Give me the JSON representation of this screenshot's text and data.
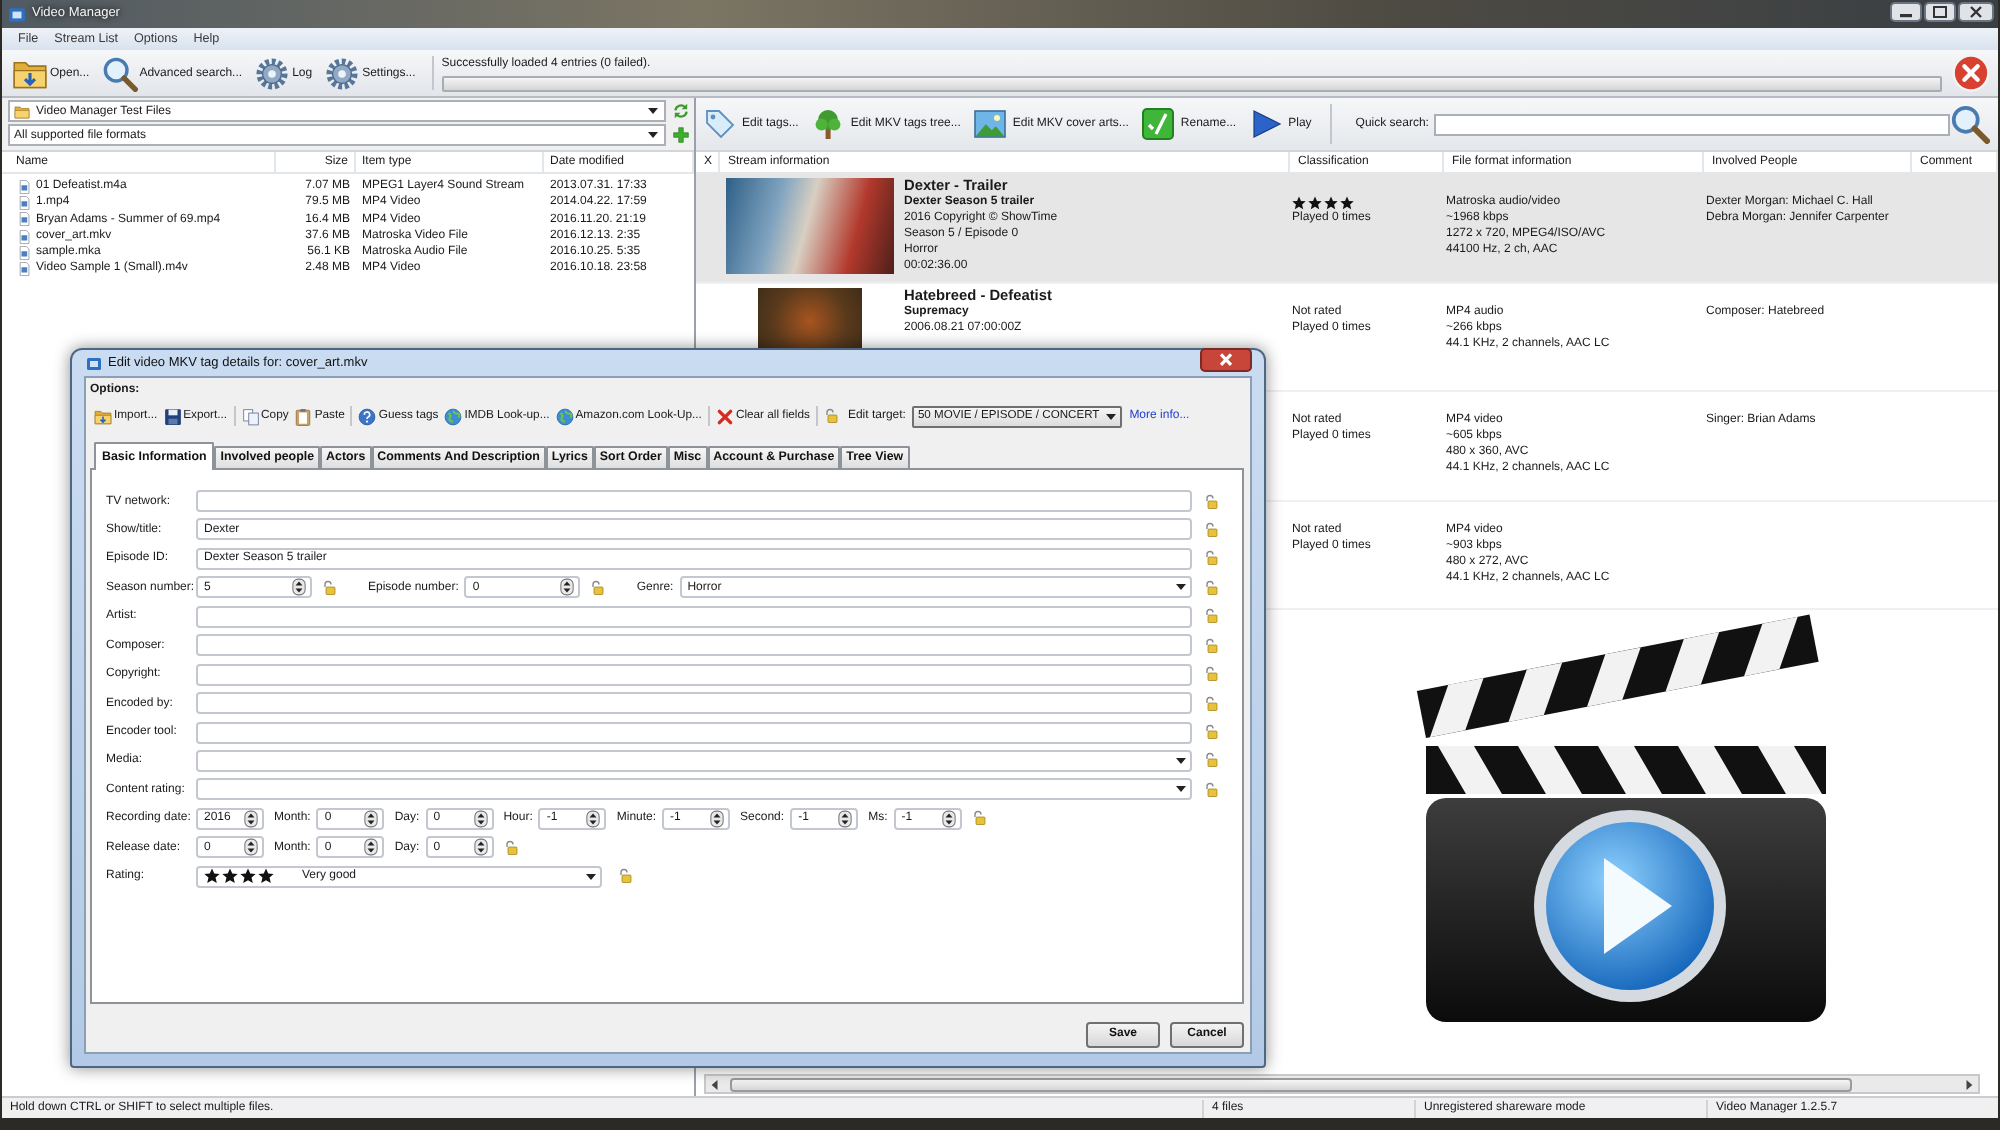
{
  "window": {
    "title": "Video Manager"
  },
  "menu": [
    "File",
    "Stream List",
    "Options",
    "Help"
  ],
  "toolbar": [
    "Open...",
    "Advanced search...",
    "Log",
    "Settings..."
  ],
  "status_message": "Successfully loaded 4 entries (0 failed).",
  "progress": {
    "level": 0
  },
  "file_panel": {
    "folder": "Video Manager Test Files",
    "filter": "All supported file formats",
    "columns": [
      "Name",
      "Size",
      "Item type",
      "Date modified"
    ],
    "rows": [
      {
        "name": "01 Defeatist.m4a",
        "size": "7.07 MB",
        "type": "MPEG1 Layer4 Sound Stream",
        "date": "2013.07.31. 17:33",
        "selected": false
      },
      {
        "name": "1.mp4",
        "size": "79.5 MB",
        "type": "MP4 Video",
        "date": "2014.04.22. 17:59",
        "selected": false
      },
      {
        "name": "Bryan Adams - Summer of 69.mp4",
        "size": "16.4 MB",
        "type": "MP4 Video",
        "date": "2016.11.20. 21:19",
        "selected": false
      },
      {
        "name": "cover_art.mkv",
        "size": "37.6 MB",
        "type": "Matroska Video File",
        "date": "2016.12.13. 2:35",
        "selected": false
      },
      {
        "name": "sample.mka",
        "size": "56.1 KB",
        "type": "Matroska Audio File",
        "date": "2016.10.25. 5:35",
        "selected": false
      },
      {
        "name": "Video Sample 1 (Small).m4v",
        "size": "2.48 MB",
        "type": "MP4 Video",
        "date": "2016.10.18. 23:58",
        "selected": false
      }
    ]
  },
  "stream_panel": {
    "toolbar": [
      "Edit tags...",
      "Edit MKV tags tree...",
      "Edit MKV cover arts...",
      "Rename...",
      "Play"
    ],
    "quick_search": {
      "label": "Quick search:"
    },
    "columns": [
      "X",
      "Stream information",
      "Classification",
      "File format information",
      "Involved People",
      "Comment"
    ],
    "rows": [
      {
        "selected": true,
        "info": {
          "kind": "video",
          "title": "Dexter - Trailer",
          "subtitle": "Dexter Season 5 trailer",
          "lines": [
            "2016 Copyright © ShowTime",
            "Season 5 / Episode 0",
            "Horror",
            "00:02:36.00"
          ]
        },
        "classification": {
          "stars": 4,
          "played": "Played 0 times"
        },
        "format": [
          "Matroska audio/video",
          "~1968 kbps",
          "1272 x 720, MPEG4/ISO/AVC",
          "44100 Hz, 2 ch, AAC"
        ],
        "people": [
          "Dexter Morgan: Michael C. Hall",
          "Debra Morgan: Jennifer Carpenter"
        ]
      },
      {
        "selected": false,
        "info": {
          "kind": "audio",
          "title": "Hatebreed - Defeatist",
          "subtitle": "Supremacy",
          "lines": [
            "2006.08.21 07:00:00Z"
          ]
        },
        "classification": {
          "rating": "Not rated",
          "played": "Played 0 times"
        },
        "format": [
          "MP4 audio",
          "~266 kbps",
          "44.1 KHz, 2 channels, AAC LC"
        ],
        "people": [
          "Composer: Hatebreed"
        ]
      },
      {
        "selected": false,
        "classification": {
          "rating": "Not rated",
          "played": "Played 0 times"
        },
        "format": [
          "MP4 video",
          "~605 kbps",
          "480 x 360, AVC",
          "44.1 KHz, 2 channels, AAC LC"
        ],
        "people": [
          "Singer: Brian Adams"
        ]
      },
      {
        "selected": false,
        "classification": {
          "rating": "Not rated",
          "played": "Played 0 times"
        },
        "format": [
          "MP4 video",
          "~903 kbps",
          "480 x 272, AVC",
          "44.1 KHz, 2 channels, AAC LC"
        ]
      }
    ]
  },
  "dialog": {
    "title": "Edit video MKV tag details for: cover_art.mkv",
    "options_label": "Options:",
    "toolbar": [
      [
        "Import...",
        "Export..."
      ],
      [
        "Copy",
        "Paste"
      ],
      [
        "Guess tags",
        "IMDB Look-up...",
        "Amazon.com Look-Up..."
      ],
      [
        "Clear all fields"
      ]
    ],
    "edit_target": {
      "label": "Edit target:",
      "value": "50 MOVIE / EPISODE / CONCERT"
    },
    "more_info": "More info...",
    "tabs": [
      {
        "label": "Basic Information",
        "selected": true
      },
      {
        "label": "Involved people",
        "selected": false
      },
      {
        "label": "Actors",
        "selected": false
      },
      {
        "label": "Comments And Description",
        "selected": false
      },
      {
        "label": "Lyrics",
        "selected": false
      },
      {
        "label": "Sort Order",
        "selected": false
      },
      {
        "label": "Misc",
        "selected": false
      },
      {
        "label": "Account & Purchase",
        "selected": false
      },
      {
        "label": "Tree View",
        "selected": false
      }
    ],
    "form": [
      {
        "kind": "text",
        "label": "TV network:"
      },
      {
        "kind": "text",
        "label": "Show/title:",
        "value": "Dexter"
      },
      {
        "kind": "text",
        "label": "Episode ID:",
        "value": "Dexter Season 5 trailer"
      },
      {
        "kind": "numbers",
        "parts": [
          {
            "kind": "spin",
            "label": "Season number:",
            "value": "5"
          },
          {
            "kind": "spin",
            "label": "Episode number:",
            "value": "0"
          },
          {
            "kind": "combo",
            "label": "Genre:",
            "value": "Horror"
          }
        ]
      },
      {
        "kind": "text",
        "label": "Artist:"
      },
      {
        "kind": "text",
        "label": "Composer:"
      },
      {
        "kind": "text",
        "label": "Copyright:"
      },
      {
        "kind": "text",
        "label": "Encoded by:"
      },
      {
        "kind": "text",
        "label": "Encoder tool:"
      },
      {
        "kind": "combo",
        "label": "Media:"
      },
      {
        "kind": "combo",
        "label": "Content rating:"
      },
      {
        "kind": "date",
        "parts": [
          {
            "kind": "spin",
            "label": "Recording date:",
            "value": "2016"
          },
          {
            "kind": "spin",
            "label": "Month:",
            "value": "0"
          },
          {
            "kind": "spin",
            "label": "Day:",
            "value": "0"
          },
          {
            "kind": "spin",
            "label": "Hour:",
            "value": "-1"
          },
          {
            "kind": "spin",
            "label": "Minute:",
            "value": "-1"
          },
          {
            "kind": "spin",
            "label": "Second:",
            "value": "-1"
          },
          {
            "kind": "spin",
            "label": "Ms:",
            "value": "-1"
          }
        ]
      },
      {
        "kind": "date",
        "parts": [
          {
            "kind": "spin",
            "label": "Release date:",
            "value": "0"
          },
          {
            "kind": "spin",
            "label": "Month:",
            "value": "0"
          },
          {
            "kind": "spin",
            "label": "Day:",
            "value": "0"
          }
        ]
      },
      {
        "kind": "rating",
        "label": "Rating:",
        "stars": 4,
        "value": "Very good"
      }
    ],
    "buttons": [
      "Save",
      "Cancel"
    ]
  },
  "status_bar": [
    "Hold down CTRL or SHIFT to select multiple files.",
    "4 files",
    "Unregistered shareware mode",
    "Video Manager 1.2.5.7"
  ]
}
